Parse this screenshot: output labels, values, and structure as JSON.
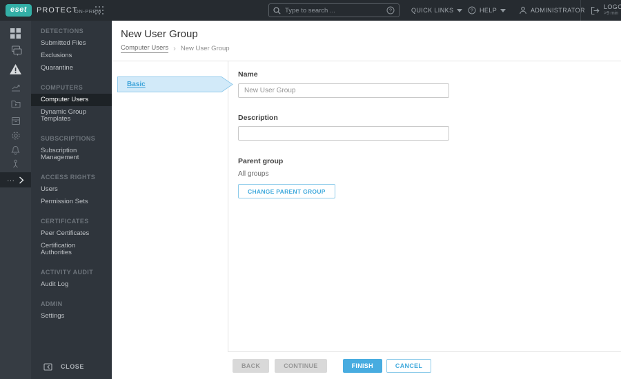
{
  "topbar": {
    "logo_text": "eset",
    "product_name": "PROTECT",
    "product_suffix": "ON-PREM",
    "search_placeholder": "Type to search ...",
    "quick_links_label": "QUICK LINKS",
    "help_label": "HELP",
    "user_label": "ADMINISTRATOR",
    "logout_label": "LOGOUT",
    "logout_sub": ">9 min"
  },
  "iconbar": {
    "icons": [
      "dashboard",
      "computers",
      "detections",
      "reports",
      "tasks",
      "installers",
      "policies",
      "notifications",
      "status-overview"
    ],
    "more_label": "..."
  },
  "sidebar": {
    "sections": [
      {
        "header": "DETECTIONS",
        "items": [
          {
            "label": "Submitted Files"
          },
          {
            "label": "Exclusions"
          },
          {
            "label": "Quarantine"
          }
        ]
      },
      {
        "header": "COMPUTERS",
        "items": [
          {
            "label": "Computer Users",
            "active": true
          },
          {
            "label": "Dynamic Group Templates"
          }
        ]
      },
      {
        "header": "SUBSCRIPTIONS",
        "items": [
          {
            "label": "Subscription Management"
          }
        ]
      },
      {
        "header": "ACCESS RIGHTS",
        "items": [
          {
            "label": "Users"
          },
          {
            "label": "Permission Sets"
          }
        ]
      },
      {
        "header": "CERTIFICATES",
        "items": [
          {
            "label": "Peer Certificates"
          },
          {
            "label": "Certification Authorities"
          }
        ]
      },
      {
        "header": "ACTIVITY AUDIT",
        "items": [
          {
            "label": "Audit Log"
          }
        ]
      },
      {
        "header": "ADMIN",
        "items": [
          {
            "label": "Settings"
          }
        ]
      }
    ],
    "close_label": "CLOSE"
  },
  "main": {
    "title": "New User Group",
    "breadcrumb": {
      "parent": "Computer Users",
      "separator": "›",
      "current": "New User Group"
    },
    "wizard": {
      "step_basic": "Basic"
    },
    "form": {
      "name_label": "Name",
      "name_value": "New User Group",
      "description_label": "Description",
      "description_value": "",
      "parent_group_label": "Parent group",
      "parent_group_value": "All groups",
      "change_parent_button": "CHANGE PARENT GROUP"
    },
    "footer": {
      "back": "BACK",
      "continue": "CONTINUE",
      "finish": "FINISH",
      "cancel": "CANCEL"
    }
  },
  "colors": {
    "accent_blue": "#48ace0",
    "blue_text": "#3fa9dc",
    "light_blue_border": "#8ecbea",
    "step_fill": "#d2eaf9",
    "eset_teal": "#33afa6",
    "topbar_bg": "#262b30",
    "rail_bg": "#363c43",
    "panel_bg": "#2f353c"
  }
}
